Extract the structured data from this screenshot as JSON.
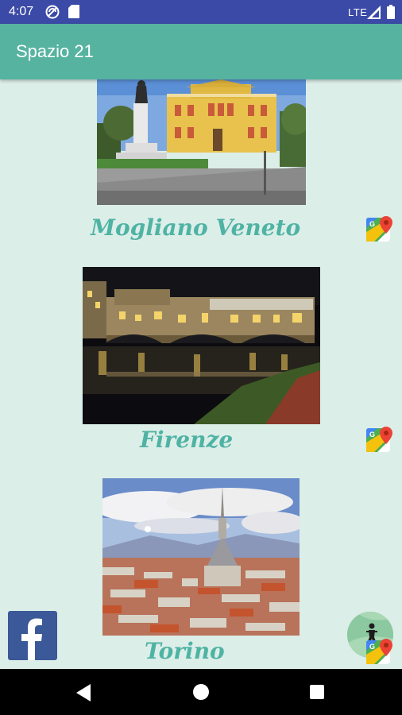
{
  "status_bar": {
    "time": "4:07",
    "network": "LTE"
  },
  "app_bar": {
    "title": "Spazio 21"
  },
  "cities": [
    {
      "name": "Mogliano Veneto",
      "photo": "town-hall-with-monument"
    },
    {
      "name": "Firenze",
      "photo": "ponte-vecchio-at-night"
    },
    {
      "name": "Torino",
      "photo": "mole-antonelliana-skyline"
    }
  ],
  "icons": {
    "maps": "google-maps-icon",
    "facebook": "facebook-icon",
    "fab": "map-person-icon"
  },
  "navigation": {
    "back": "back-icon",
    "home": "home-icon",
    "recents": "recents-icon"
  },
  "colors": {
    "status_bar": "#3b4aa6",
    "app_bar": "#56b3a0",
    "background": "#dceee8",
    "city_name": "#4fb3a4",
    "facebook": "#3b5998"
  }
}
